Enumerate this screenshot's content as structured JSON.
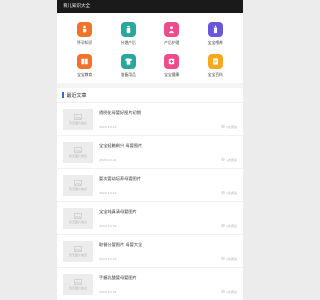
{
  "topbar": {
    "title": "育儿知识大全"
  },
  "categories": [
    {
      "label": "怀孕知识",
      "color": "#f0722b",
      "icon": "pregnant-icon"
    },
    {
      "label": "分娩产后",
      "color": "#2aa69a",
      "icon": "baby-bottle-icon"
    },
    {
      "label": "产后护理",
      "color": "#f04a8c",
      "icon": "care-icon"
    },
    {
      "label": "宝宝喂养",
      "color": "#6a57d8",
      "icon": "bottle-icon"
    },
    {
      "label": "宝宝教育",
      "color": "#f0722b",
      "icon": "book-icon"
    },
    {
      "label": "准备用品",
      "color": "#2aa69a",
      "icon": "shirt-icon"
    },
    {
      "label": "宝宝健康",
      "color": "#f04a8c",
      "icon": "health-icon"
    },
    {
      "label": "宝宝百科",
      "color": "#f5a91c",
      "icon": "encyclopedia-icon"
    }
  ],
  "recent": {
    "title": "最近文章",
    "thumb_label": "暂无图片信息",
    "items": [
      {
        "title": "透明化母婴好图片初期",
        "date": "2020-10-10",
        "views": "1次阅读"
      },
      {
        "title": "宝宝轻触刷兴 母婴图片",
        "date": "2020-10-10",
        "views": "1次阅读"
      },
      {
        "title": "婴次婴幼培养母婴图片",
        "date": "2020-10-10",
        "views": "1次阅读"
      },
      {
        "title": "宝宝纯真清母婴图片",
        "date": "2020-10-10",
        "views": "1次阅读"
      },
      {
        "title": "取餐分婴图片 母婴大全",
        "date": "2020-10-10",
        "views": "1次阅读"
      },
      {
        "title": "手握乳酸婴母婴图片",
        "date": "2020-10-10",
        "views": "1次阅读"
      }
    ]
  }
}
